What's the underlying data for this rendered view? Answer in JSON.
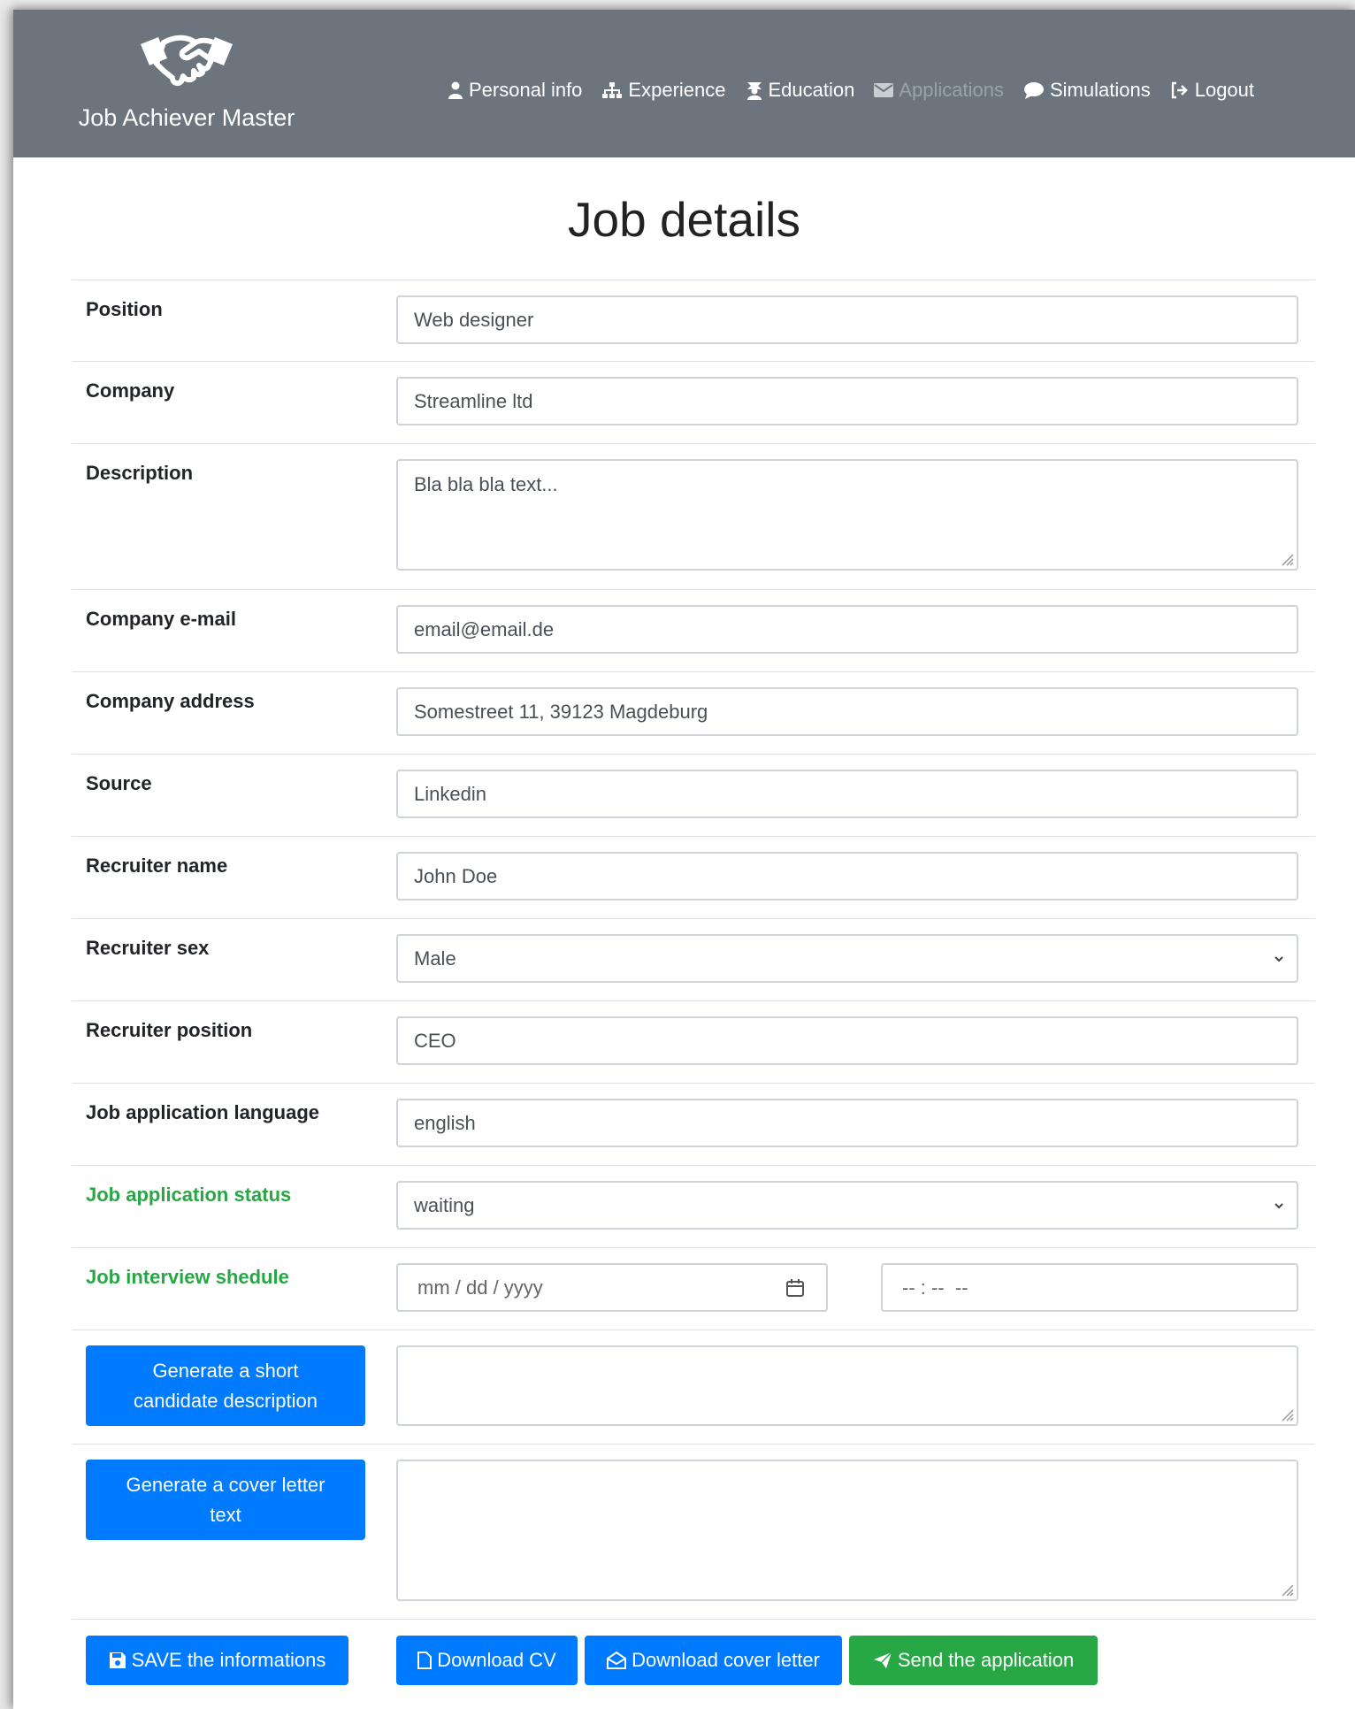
{
  "brand": {
    "name": "Job Achiever Master"
  },
  "nav": {
    "items": [
      {
        "label": "Personal info",
        "icon": "user-icon"
      },
      {
        "label": "Experience",
        "icon": "sitemap-icon"
      },
      {
        "label": "Education",
        "icon": "graduate-icon"
      },
      {
        "label": "Applications",
        "icon": "envelope-icon"
      },
      {
        "label": "Simulations",
        "icon": "comment-icon"
      },
      {
        "label": "Logout",
        "icon": "logout-icon"
      }
    ]
  },
  "page": {
    "title": "Job details"
  },
  "fields": {
    "position": {
      "label": "Position",
      "value": "Web designer"
    },
    "company": {
      "label": "Company",
      "value": "Streamline ltd"
    },
    "description": {
      "label": "Description",
      "value": "Bla bla bla text..."
    },
    "company_email": {
      "label": "Company e-mail",
      "value": "email@email.de"
    },
    "company_address": {
      "label": "Company address",
      "value": "Somestreet 11, 39123 Magdeburg"
    },
    "source": {
      "label": "Source",
      "value": "Linkedin"
    },
    "recruiter_name": {
      "label": "Recruiter name",
      "value": "John Doe"
    },
    "recruiter_sex": {
      "label": "Recruiter sex",
      "value": "Male"
    },
    "recruiter_position": {
      "label": "Recruiter position",
      "value": "CEO"
    },
    "language": {
      "label": "Job application language",
      "value": "english"
    },
    "status": {
      "label": "Job application status",
      "value": "waiting"
    },
    "interview": {
      "label": "Job interview shedule",
      "date_placeholder": "mm / dd / yyyy",
      "time_placeholder": "-- : --  --"
    }
  },
  "actions": {
    "generate_description": "Generate a short candidate description",
    "generate_cover_letter": "Generate a cover letter text",
    "save": "SAVE the informations",
    "download_cv": "Download CV",
    "download_cover_letter": "Download cover letter",
    "send": "Send the application"
  },
  "colors": {
    "navbar": "#6c757d",
    "primary": "#007bff",
    "success": "#28a745"
  }
}
